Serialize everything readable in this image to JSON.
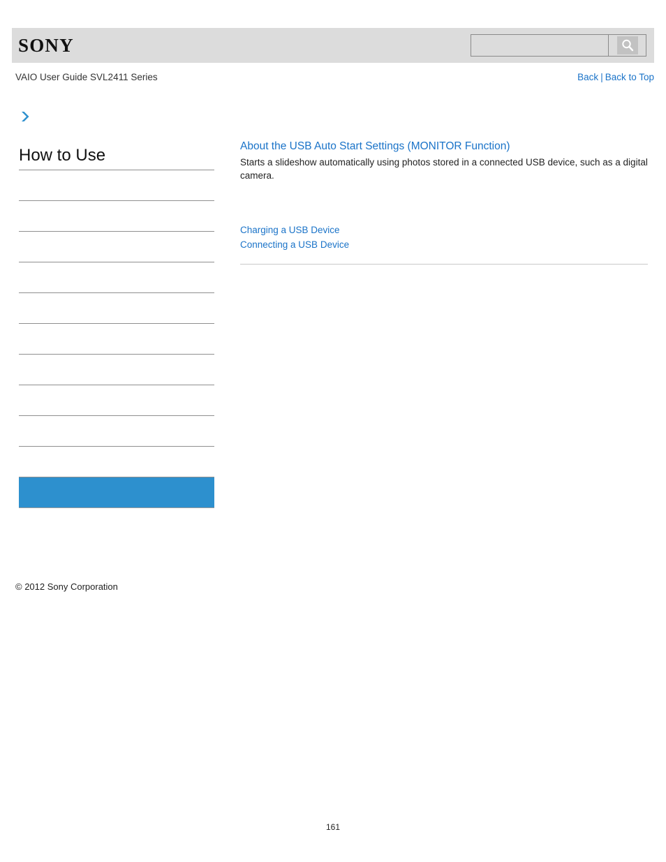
{
  "header": {
    "logo_text": "SONY",
    "search": {
      "value": "",
      "placeholder": "",
      "icon": "search-icon"
    }
  },
  "titlebar": {
    "guide_title": "VAIO User Guide SVL2411 Series",
    "back_label": "Back",
    "separator": "|",
    "back_to_top_label": "Back to Top"
  },
  "sidebar": {
    "arrow_icon": "chevron-right-icon",
    "heading": "How to Use",
    "items": [
      {
        "label": "",
        "selected": false
      },
      {
        "label": "",
        "selected": false
      },
      {
        "label": "",
        "selected": false
      },
      {
        "label": "",
        "selected": false
      },
      {
        "label": "",
        "selected": false
      },
      {
        "label": "",
        "selected": false
      },
      {
        "label": "",
        "selected": false
      },
      {
        "label": "",
        "selected": false
      },
      {
        "label": "",
        "selected": false
      },
      {
        "label": "",
        "selected": false
      },
      {
        "label": "",
        "selected": true
      }
    ],
    "copyright": "© 2012 Sony Corporation"
  },
  "main": {
    "heading": "About the USB Auto Start Settings (MONITOR Function)",
    "description": "Starts a slideshow automatically using photos stored in a connected USB device, such as a digital camera.",
    "related_links": [
      "Charging a USB Device",
      "Connecting a USB Device"
    ]
  },
  "footer": {
    "page_number": "161"
  },
  "colors": {
    "link_blue": "#1a73c8",
    "selected_blue": "#2d90ce",
    "header_gray": "#dcdcdc",
    "rule_gray": "#8f8f8f"
  }
}
